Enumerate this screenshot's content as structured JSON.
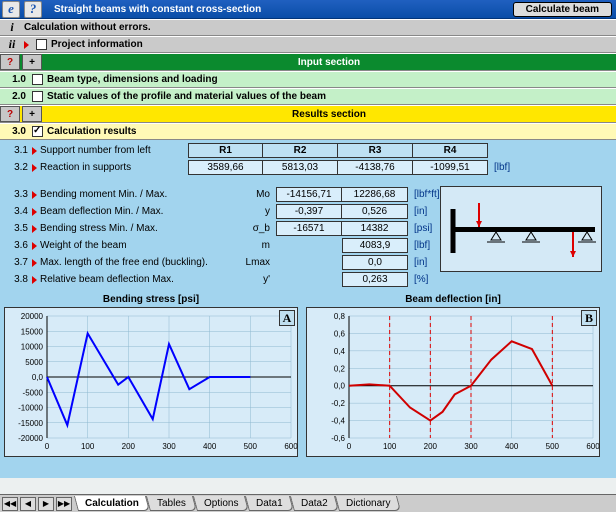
{
  "titlebar": {
    "app_icon": "e",
    "help_icon": "?",
    "title": "Straight beams with constant cross-section",
    "calc_btn": "Calculate beam"
  },
  "status_i": {
    "idx": "i",
    "text": "Calculation without errors."
  },
  "status_ii": {
    "idx": "ii",
    "text": "Project information"
  },
  "input_section": {
    "q": "?",
    "plus": "+",
    "label": "Input section",
    "rows": [
      {
        "idx": "1.0",
        "text": "Beam type, dimensions and loading"
      },
      {
        "idx": "2.0",
        "text": "Static values of the profile and material values of the beam"
      }
    ]
  },
  "results_section": {
    "q": "?",
    "plus": "+",
    "label": "Results section",
    "row30": {
      "idx": "3.0",
      "text": "Calculation results"
    }
  },
  "support_table": {
    "row_label_31": {
      "idx": "3.1",
      "text": "Support number from left"
    },
    "row_label_32": {
      "idx": "3.2",
      "text": "Reaction in supports"
    },
    "headers": [
      "R1",
      "R2",
      "R3",
      "R4"
    ],
    "values": [
      "3589,66",
      "5813,03",
      "-4138,76",
      "-1099,51"
    ],
    "unit": "[lbf]"
  },
  "metrics": [
    {
      "idx": "3.3",
      "label": "Bending moment Min. / Max.",
      "sym": "Mo",
      "v1": "-14156,71",
      "v2": "12286,68",
      "unit": "[lbf*ft]"
    },
    {
      "idx": "3.4",
      "label": "Beam deflection Min. / Max.",
      "sym": "y",
      "v1": "-0,397",
      "v2": "0,526",
      "unit": "[in]"
    },
    {
      "idx": "3.5",
      "label": "Bending stress Min. / Max.",
      "sym": "σ_b",
      "v1": "-16571",
      "v2": "14382",
      "unit": "[psi]"
    },
    {
      "idx": "3.6",
      "label": "Weight of the beam",
      "sym": "m",
      "v1": "",
      "v2": "4083,9",
      "unit": "[lbf]"
    },
    {
      "idx": "3.7",
      "label": "Max. length of the free end (buckling).",
      "sym": "Lmax",
      "v1": "",
      "v2": "0,0",
      "unit": "[in]"
    },
    {
      "idx": "3.8",
      "label": "Relative beam deflection Max.",
      "sym": "y'",
      "v1": "",
      "v2": "0,263",
      "unit": "[%]"
    }
  ],
  "chart_titles": {
    "stress": "Bending stress  [psi]",
    "defl": "Beam deflection  [in]"
  },
  "chart_corner": {
    "a": "A",
    "b": "B"
  },
  "tabs": {
    "nav": [
      "◀◀",
      "◀",
      "▶",
      "▶▶"
    ],
    "items": [
      "Calculation",
      "Tables",
      "Options",
      "Data1",
      "Data2",
      "Dictionary"
    ]
  },
  "chart_data": [
    {
      "type": "line",
      "title": "Bending stress [psi]",
      "xlabel": "",
      "ylabel": "",
      "xlim": [
        0,
        600
      ],
      "ylim": [
        -20000,
        20000
      ],
      "x_ticks": [
        0,
        100,
        200,
        300,
        400,
        500,
        600
      ],
      "y_ticks": [
        -20000,
        -15000,
        -10000,
        -5000,
        0,
        5000,
        10000,
        15000,
        20000
      ],
      "series": [
        {
          "name": "stress",
          "color": "#0000ff",
          "x": [
            0,
            50,
            100,
            175,
            200,
            260,
            300,
            350,
            400,
            500
          ],
          "values": [
            0,
            -15800,
            14300,
            -2500,
            0,
            -13800,
            10800,
            -4000,
            0,
            0
          ]
        }
      ]
    },
    {
      "type": "line",
      "title": "Beam deflection [in]",
      "xlabel": "",
      "ylabel": "",
      "xlim": [
        0,
        600
      ],
      "ylim": [
        -0.6,
        0.8
      ],
      "x_ticks": [
        0,
        100,
        200,
        300,
        400,
        500,
        600
      ],
      "y_ticks": [
        -0.6,
        -0.4,
        -0.2,
        0,
        0.2,
        0.4,
        0.6,
        0.8
      ],
      "vlines_x": [
        100,
        200,
        300,
        500
      ],
      "series": [
        {
          "name": "deflection",
          "color": "#d00000",
          "x": [
            0,
            50,
            100,
            150,
            200,
            230,
            260,
            300,
            350,
            400,
            450,
            500
          ],
          "values": [
            0,
            0.015,
            0,
            -0.25,
            -0.4,
            -0.3,
            -0.1,
            0,
            0.3,
            0.51,
            0.42,
            0
          ]
        }
      ]
    }
  ]
}
